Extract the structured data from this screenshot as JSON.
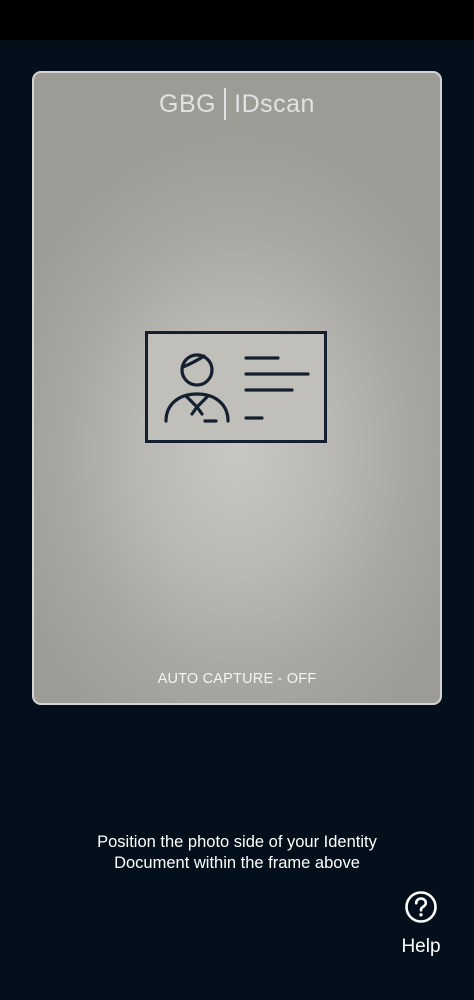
{
  "camera": {
    "logo_left": "GBG",
    "logo_right": "IDscan",
    "capture_status": "AUTO CAPTURE - OFF",
    "card_icon": "id-card-icon"
  },
  "instructions": {
    "line1": "Position the photo side of your Identity",
    "line2": "Document within the frame above"
  },
  "help": {
    "icon": "question-circle-icon",
    "label": "Help"
  },
  "colors": {
    "background": "#040f1c",
    "frame_border": "#d4d4d4",
    "card_outline": "#142030",
    "text": "#ffffff"
  }
}
